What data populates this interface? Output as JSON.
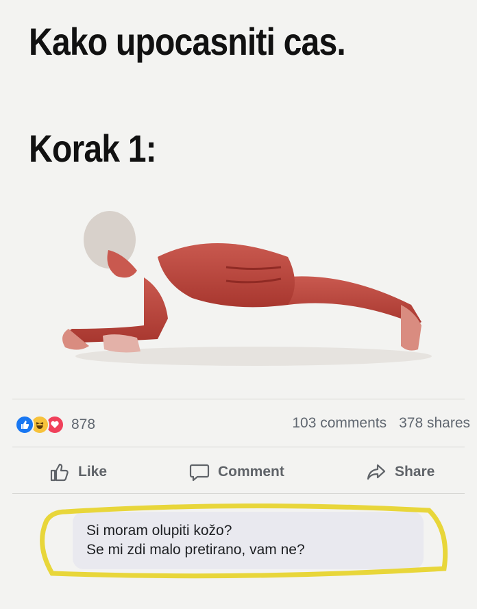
{
  "meme": {
    "title_line1": "Kako upocasniti cas.",
    "title_line2": "Korak 1:"
  },
  "post": {
    "reaction_count": "878",
    "comments": "103 comments",
    "shares": "378 shares",
    "reactions": [
      "like-icon",
      "haha-icon",
      "love-icon"
    ]
  },
  "actions": {
    "like_label": "Like",
    "comment_label": "Comment",
    "share_label": "Share"
  },
  "comment": {
    "line1": "Si moram olupiti kožo?",
    "line2": "Se mi zdi malo pretirano, vam ne?"
  },
  "colors": {
    "like_blue": "#1877f2",
    "haha_yellow": "#f7c23b",
    "love_red": "#f0405a",
    "highlight_yellow": "#e8d63a"
  }
}
